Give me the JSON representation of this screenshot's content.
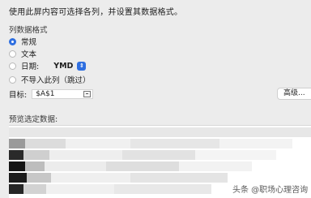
{
  "intro": "使用此屏内容可选择各列，并设置其数据格式。",
  "column_format": {
    "title": "列数据格式",
    "options": [
      {
        "label": "常规",
        "selected": true
      },
      {
        "label": "文本",
        "selected": false
      },
      {
        "label": "日期:",
        "selected": false
      },
      {
        "label": "不导入此列（跳过）",
        "selected": false
      }
    ],
    "date_format": "YMD"
  },
  "target": {
    "label": "目标:",
    "value": "$A$1"
  },
  "advanced_button": "高级...",
  "preview_label": "预览选定数据:",
  "watermark": "头条 @职场心理咨询",
  "colors": {
    "accent": "#2f6fe0",
    "background": "#ececec"
  }
}
